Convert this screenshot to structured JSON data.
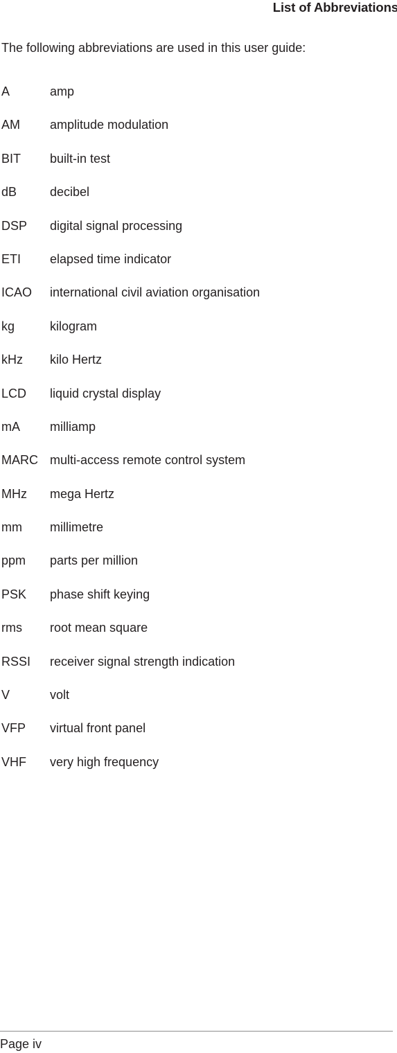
{
  "header": {
    "title": "List of Abbreviations"
  },
  "body": {
    "intro": "The following abbreviations are used in this user guide:",
    "abbreviations": [
      {
        "term": "A",
        "definition": "amp"
      },
      {
        "term": "AM",
        "definition": "amplitude modulation"
      },
      {
        "term": "BIT",
        "definition": "built-in test"
      },
      {
        "term": "dB",
        "definition": "decibel"
      },
      {
        "term": "DSP",
        "definition": "digital signal processing"
      },
      {
        "term": "ETI",
        "definition": "elapsed time indicator"
      },
      {
        "term": "ICAO",
        "definition": "international civil aviation organisation"
      },
      {
        "term": "kg",
        "definition": "kilogram"
      },
      {
        "term": "kHz",
        "definition": "kilo Hertz"
      },
      {
        "term": "LCD",
        "definition": "liquid crystal display"
      },
      {
        "term": "mA",
        "definition": "milliamp"
      },
      {
        "term": "MARC",
        "definition": "multi-access remote control system"
      },
      {
        "term": "MHz",
        "definition": "mega Hertz"
      },
      {
        "term": "mm",
        "definition": "millimetre"
      },
      {
        "term": "ppm",
        "definition": "parts per million"
      },
      {
        "term": "PSK",
        "definition": "phase shift keying"
      },
      {
        "term": "rms",
        "definition": "root mean square"
      },
      {
        "term": "RSSI",
        "definition": "receiver signal strength indication"
      },
      {
        "term": "V",
        "definition": "volt"
      },
      {
        "term": "VFP",
        "definition": "virtual front panel"
      },
      {
        "term": "VHF",
        "definition": "very high frequency"
      }
    ]
  },
  "footer": {
    "page_label": "Page iv"
  },
  "colors": {
    "text": "#231f20",
    "rule": "#8d8d8d",
    "background": "#ffffff"
  }
}
